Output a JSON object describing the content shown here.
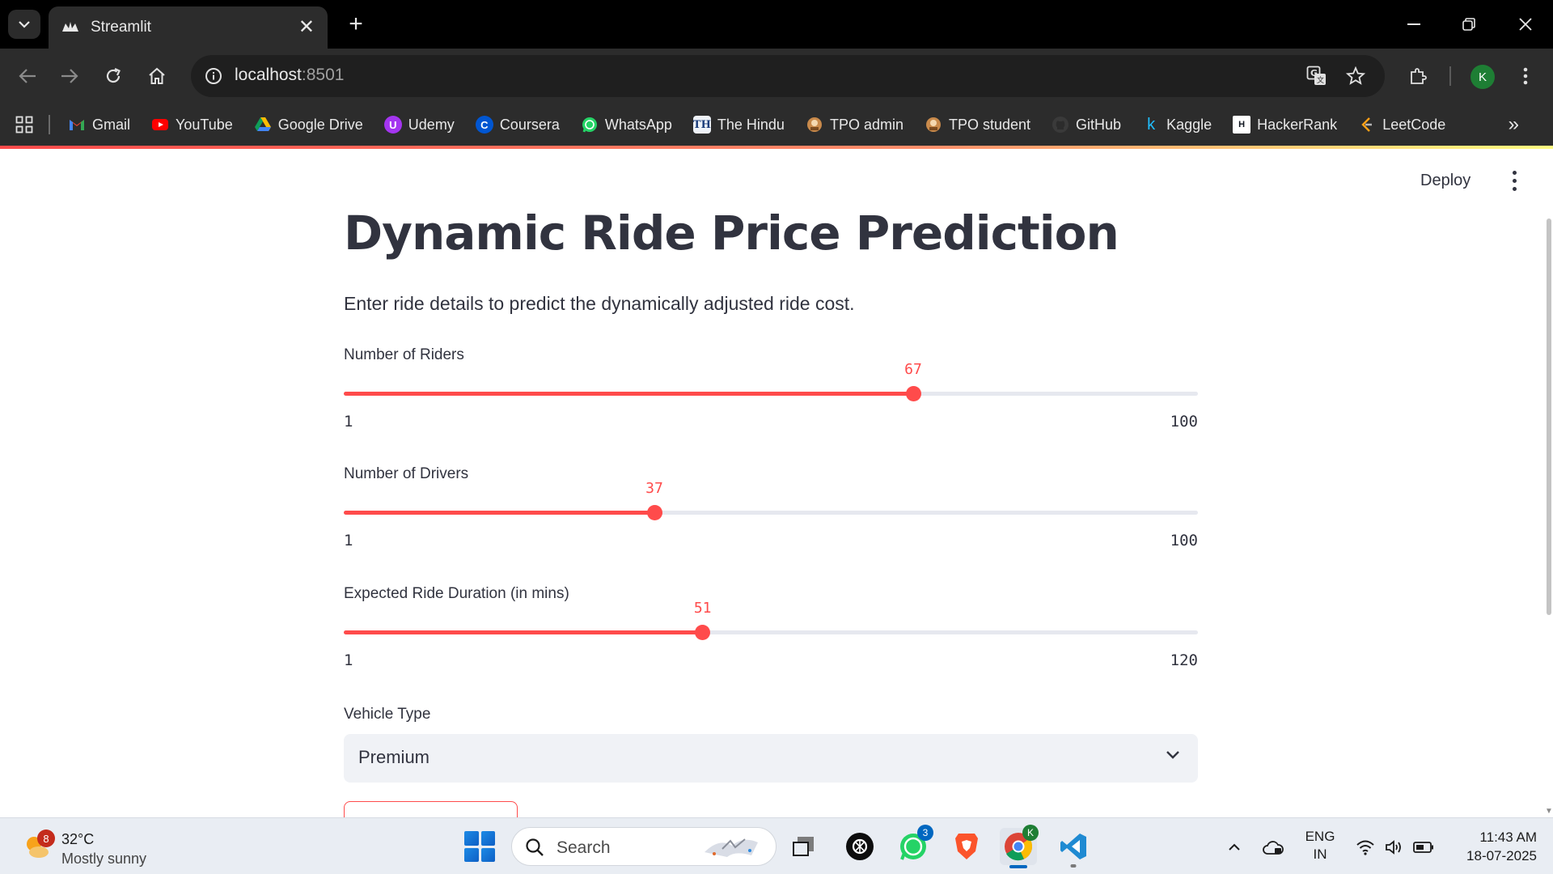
{
  "browser": {
    "tab_title": "Streamlit",
    "url_host": "localhost",
    "url_port": ":8501",
    "profile_initial": "K",
    "bookmarks": [
      {
        "label": "Gmail",
        "icon": "gmail-icon"
      },
      {
        "label": "YouTube",
        "icon": "youtube-icon"
      },
      {
        "label": "Google Drive",
        "icon": "google-drive-icon"
      },
      {
        "label": "Udemy",
        "icon": "udemy-icon"
      },
      {
        "label": "Coursera",
        "icon": "coursera-icon"
      },
      {
        "label": "WhatsApp",
        "icon": "whatsapp-icon"
      },
      {
        "label": "The Hindu",
        "icon": "the-hindu-icon"
      },
      {
        "label": "TPO admin",
        "icon": "tpo-icon"
      },
      {
        "label": "TPO student",
        "icon": "tpo-icon"
      },
      {
        "label": "GitHub",
        "icon": "github-icon"
      },
      {
        "label": "Kaggle",
        "icon": "kaggle-icon"
      },
      {
        "label": "HackerRank",
        "icon": "hackerrank-icon"
      },
      {
        "label": "LeetCode",
        "icon": "leetcode-icon"
      }
    ]
  },
  "app": {
    "deploy_label": "Deploy",
    "title": "Dynamic Ride Price Prediction",
    "subtitle": "Enter ride details to predict the dynamically adjusted ride cost.",
    "accent_color": "#ff4b4b",
    "sliders": [
      {
        "label": "Number of Riders",
        "value": 67,
        "min": 1,
        "max": 100
      },
      {
        "label": "Number of Drivers",
        "value": 37,
        "min": 1,
        "max": 100
      },
      {
        "label": "Expected Ride Duration (in mins)",
        "value": 51,
        "min": 1,
        "max": 120
      }
    ],
    "vehicle_type": {
      "label": "Vehicle Type",
      "selected": "Premium"
    }
  },
  "taskbar": {
    "weather_temp": "32°C",
    "weather_desc": "Mostly sunny",
    "weather_badge": "8",
    "search_placeholder": "Search",
    "whatsapp_badge": "3",
    "chrome_profile": "K",
    "lang_line1": "ENG",
    "lang_line2": "IN",
    "time": "11:43 AM",
    "date": "18-07-2025"
  }
}
